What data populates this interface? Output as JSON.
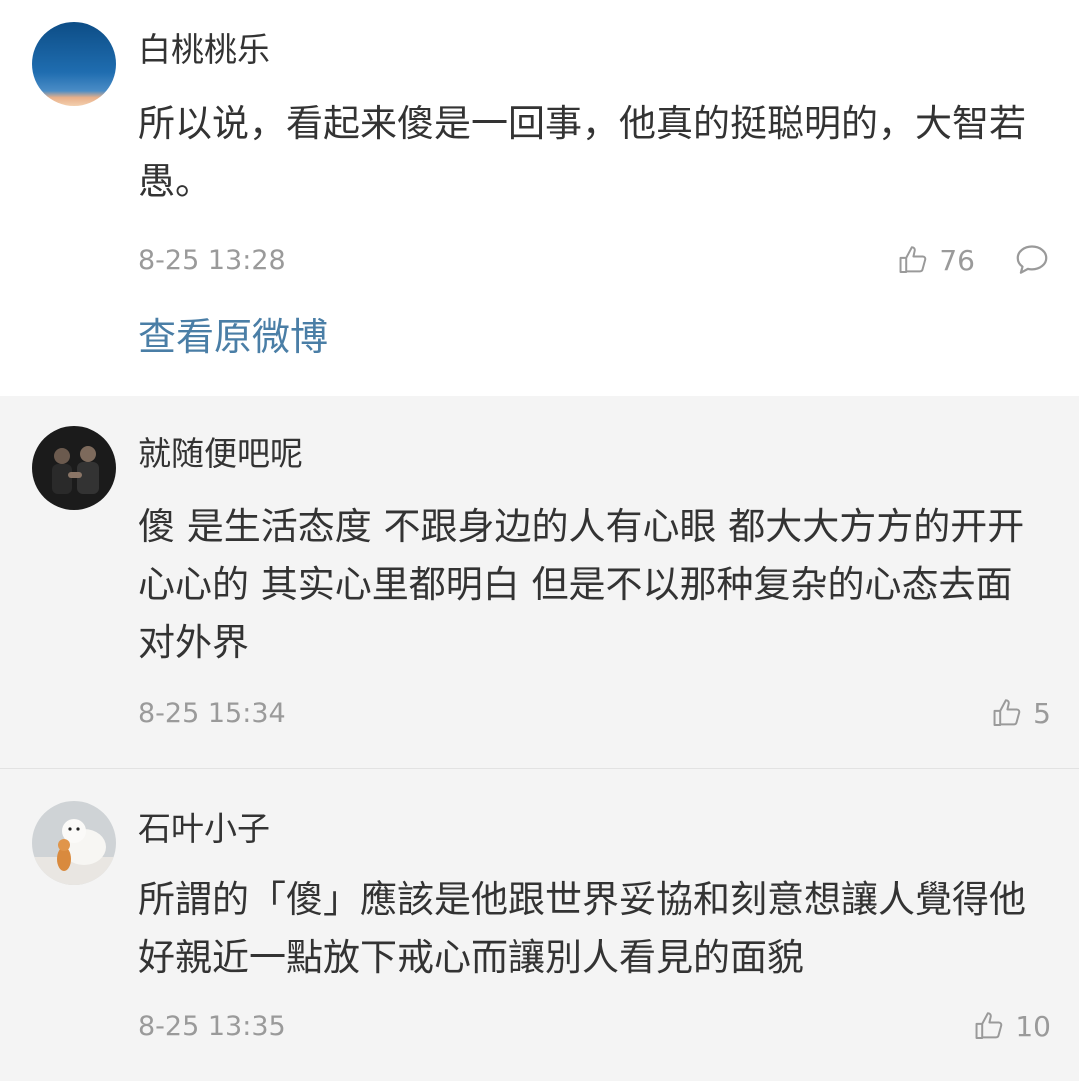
{
  "comments": [
    {
      "username": "白桃桃乐",
      "text": "所以说，看起来傻是一回事，他真的挺聪明的，大智若愚。",
      "time": "8-25 13:28",
      "likes": "76",
      "view_original": "查看原微博"
    },
    {
      "username": "就随便吧呢",
      "text": "傻 是生活态度 不跟身边的人有心眼 都大大方方的开开心心的 其实心里都明白 但是不以那种复杂的心态去面对外界",
      "time": "8-25 15:34",
      "likes": "5"
    },
    {
      "username": "石叶小子",
      "text": "所謂的「傻」應該是他跟世界妥協和刻意想讓人覺得他好親近一點放下戒心而讓別人看見的面貌",
      "time": "8-25 13:35",
      "likes": "10"
    }
  ],
  "icons": {
    "like": "thumbs-up-icon",
    "reply": "comment-bubble-icon"
  },
  "colors": {
    "link": "#4a7ea6",
    "meta": "#9a9a9a",
    "text": "#333333"
  }
}
